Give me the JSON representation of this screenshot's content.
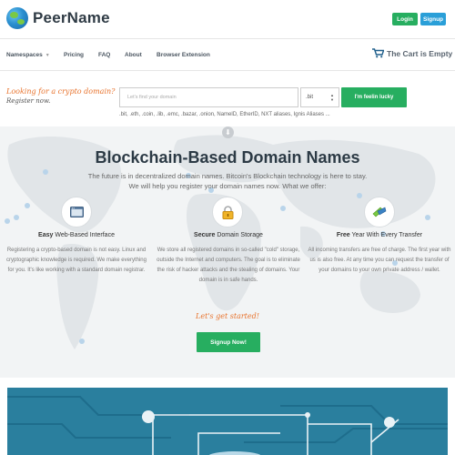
{
  "header": {
    "logo_text": "PeerName",
    "login_label": "Login",
    "signup_label": "Signup"
  },
  "nav": {
    "items": [
      {
        "label": "Namespaces",
        "has_caret": true
      },
      {
        "label": "Pricing"
      },
      {
        "label": "FAQ"
      },
      {
        "label": "About"
      },
      {
        "label": "Browser Extension"
      }
    ],
    "cart_label": "The Cart is Empty"
  },
  "search": {
    "tagline_line1": "Looking for a crypto domain?",
    "tagline_line2": "Register now.",
    "placeholder": "Let's find your domain",
    "tld_selected": ".bit",
    "lucky_label": "I'm feelin lucky",
    "tld_list": ".bit, .eth, .coin, .lib, .emc, .bazar, .onion, NamelD, EtherID, NXT aliases, Ignis Aliases ..."
  },
  "hero": {
    "title": "Blockchain-Based Domain Names",
    "subtitle_line1": "The future is in decentralized domain names. Bitcoin's Blockchain technology is here to stay.",
    "subtitle_line2": "We will help you register your domain names now. What we offer:",
    "features": [
      {
        "title_bold": "Easy",
        "title_rest": " Web-Based Interface",
        "description": "Registering a crypto-based domain is not easy. Linux and cryptographic knowledge is required. We make everything for you. It's like working with a standard domain registrar.",
        "icon": "browser-window-icon"
      },
      {
        "title_bold": "Secure",
        "title_rest": " Domain Storage",
        "description": "We store all registered domains in so-called \"cold\" storage, outside the Internet and computers. The goal is to eliminate the risk of hacker attacks and the stealing of domains. Your domain is in safe hands.",
        "icon": "padlock-icon"
      },
      {
        "title_bold": "Free",
        "title_rest": " Year With Every Transfer",
        "description": "All incoming transfers are free of charge. The first year with us is also free. At any time you can request the transfer of your domains to your own private address / wallet.",
        "icon": "transfer-arrows-icon"
      }
    ],
    "get_started": "Let's get started!",
    "signup_now_label": "Signup Now!"
  },
  "colors": {
    "green": "#27ae60",
    "blue": "#2a9fd8",
    "orange": "#e8732d",
    "banner": "#2a7f9e"
  }
}
